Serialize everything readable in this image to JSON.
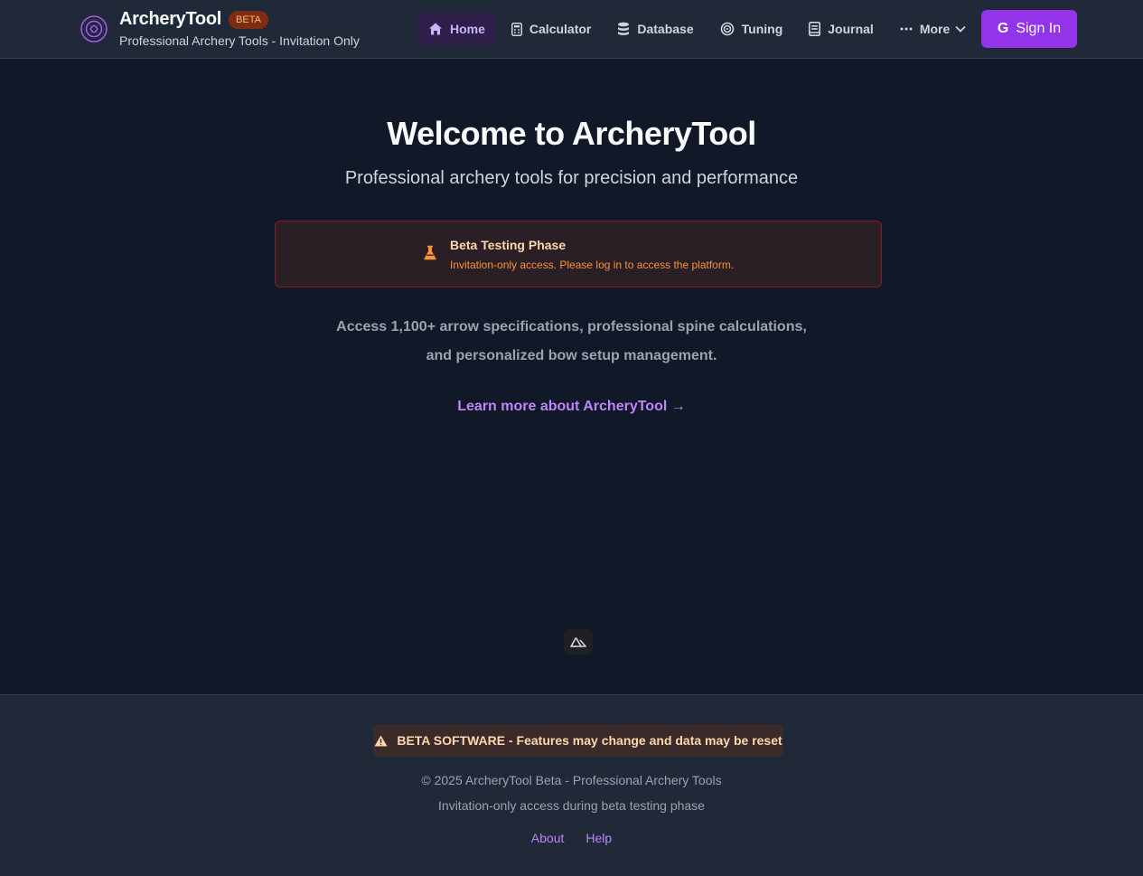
{
  "header": {
    "brand_name": "ArcheryTool",
    "beta_badge": "BETA",
    "brand_subtitle": "Professional Archery Tools - Invitation Only",
    "nav": [
      {
        "label": "Home",
        "icon": "home-icon",
        "active": true
      },
      {
        "label": "Calculator",
        "icon": "calculator-icon"
      },
      {
        "label": "Database",
        "icon": "database-icon"
      },
      {
        "label": "Tuning",
        "icon": "target-icon"
      },
      {
        "label": "Journal",
        "icon": "book-icon"
      },
      {
        "label": "More",
        "icon": "ellipsis-icon"
      }
    ],
    "sign_in": {
      "label": "Sign In",
      "icon": "google-icon"
    }
  },
  "main": {
    "title": "Welcome to ArcheryTool",
    "tagline": "Professional archery tools for precision and performance",
    "beta_notice": {
      "title": "Beta Testing Phase",
      "description": "Invitation-only access. Please log in to access the platform.",
      "icon": "flask-icon"
    },
    "access_line1": "Access 1,100+ arrow specifications, professional spine calculations,",
    "access_line2": "and personalized bow setup management.",
    "learn_more": "Learn more about ArcheryTool →"
  },
  "footer": {
    "warning": "BETA SOFTWARE - Features may change and data may be reset",
    "copyright": "© 2025 ArcheryTool Beta - Professional Archery Tools",
    "invite_note": "Invitation-only access during beta testing phase",
    "links": {
      "about": "About",
      "help": "Help"
    }
  },
  "colors": {
    "accent": "#9333ea",
    "link": "#c084fc",
    "background": "#111827",
    "header": "#1f2937"
  }
}
